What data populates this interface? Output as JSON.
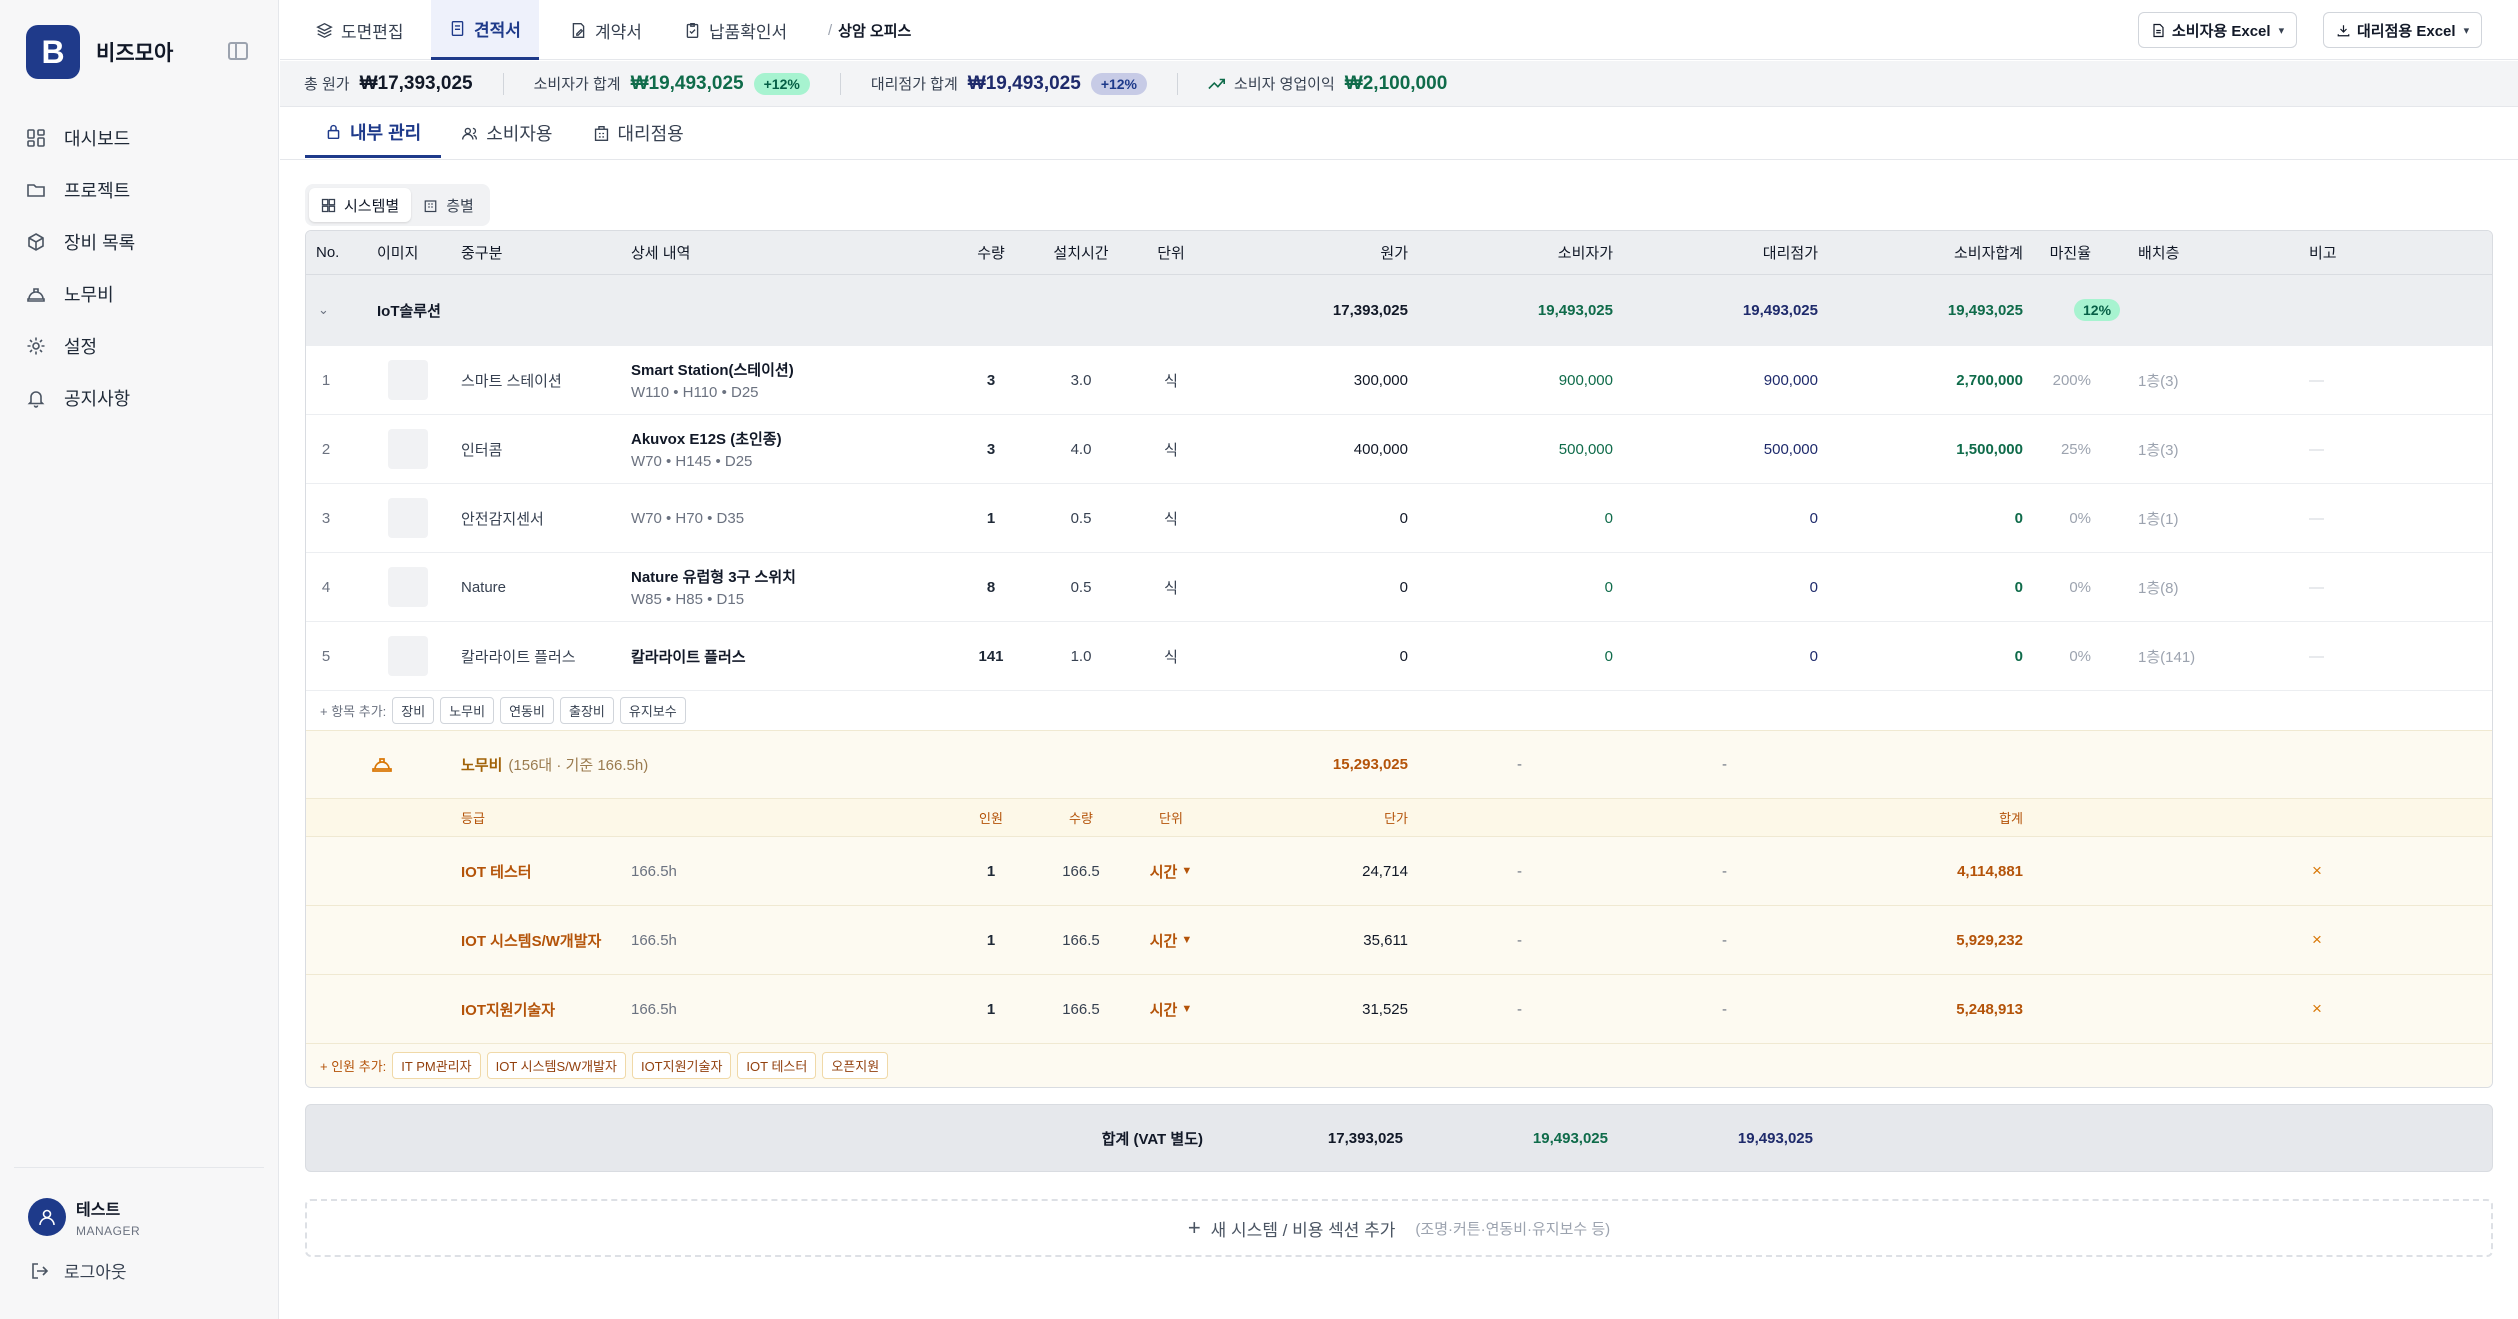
{
  "app": {
    "logo_letter": "B",
    "name": "비즈모아"
  },
  "sidebar": {
    "items": [
      {
        "label": "대시보드",
        "icon": "dashboard-icon"
      },
      {
        "label": "프로젝트",
        "icon": "folder-icon"
      },
      {
        "label": "장비 목록",
        "icon": "box-icon"
      },
      {
        "label": "노무비",
        "icon": "hardhat-icon"
      },
      {
        "label": "설정",
        "icon": "gear-icon"
      },
      {
        "label": "공지사항",
        "icon": "bell-icon"
      }
    ],
    "user": {
      "name": "테스트",
      "role": "MANAGER"
    },
    "logout": "로그아웃"
  },
  "top_tabs": [
    "도면편집",
    "견적서",
    "계약서",
    "납품확인서"
  ],
  "breadcrumb": {
    "sep": "/",
    "current": "상암 오피스"
  },
  "export": {
    "consumer": "소비자용 Excel",
    "dealer": "대리점용 Excel"
  },
  "summary": {
    "cost_label": "총 원가",
    "cost_value": "₩17,393,025",
    "consumer_label": "소비자가 합계",
    "consumer_value": "₩19,493,025",
    "consumer_pct": "+12%",
    "dealer_label": "대리점가 합계",
    "dealer_value": "₩19,493,025",
    "dealer_pct": "+12%",
    "profit_label": "소비자 영업이익",
    "profit_value": "₩2,100,000"
  },
  "sub_tabs": [
    "내부 관리",
    "소비자용",
    "대리점용"
  ],
  "view_toggle": [
    "시스템별",
    "층별"
  ],
  "table": {
    "headers": [
      "No.",
      "이미지",
      "중구분",
      "상세 내역",
      "수량",
      "설치시간",
      "단위",
      "원가",
      "소비자가",
      "대리점가",
      "소비자합계",
      "마진율",
      "배치층",
      "비고"
    ],
    "group": {
      "name": "IoT솔루션",
      "cost": "17,393,025",
      "consumer": "19,493,025",
      "dealer": "19,493,025",
      "consumer_total": "19,493,025",
      "margin": "12%"
    },
    "rows": [
      {
        "no": "1",
        "category": "스마트 스테이션",
        "title": "Smart Station(스테이션)",
        "spec": "W110 • H110 • D25",
        "qty": "3",
        "time": "3.0",
        "unit": "식",
        "cost": "300,000",
        "consumer": "900,000",
        "dealer": "900,000",
        "total": "2,700,000",
        "margin": "200%",
        "floor": "1층(3)",
        "note": "—"
      },
      {
        "no": "2",
        "category": "인터콤",
        "title": "Akuvox E12S (초인종)",
        "spec": "W70 • H145 • D25",
        "qty": "3",
        "time": "4.0",
        "unit": "식",
        "cost": "400,000",
        "consumer": "500,000",
        "dealer": "500,000",
        "total": "1,500,000",
        "margin": "25%",
        "floor": "1층(3)",
        "note": "—"
      },
      {
        "no": "3",
        "category": "안전감지센서",
        "title": "",
        "spec": "W70 • H70 • D35",
        "qty": "1",
        "time": "0.5",
        "unit": "식",
        "cost": "0",
        "consumer": "0",
        "dealer": "0",
        "total": "0",
        "margin": "0%",
        "floor": "1층(1)",
        "note": "—"
      },
      {
        "no": "4",
        "category": "Nature",
        "title": "Nature 유럽형 3구 스위치",
        "spec": "W85 • H85 • D15",
        "qty": "8",
        "time": "0.5",
        "unit": "식",
        "cost": "0",
        "consumer": "0",
        "dealer": "0",
        "total": "0",
        "margin": "0%",
        "floor": "1층(8)",
        "note": "—"
      },
      {
        "no": "5",
        "category": "칼라라이트 플러스",
        "title": "칼라라이트 플러스",
        "spec": "",
        "qty": "141",
        "time": "1.0",
        "unit": "식",
        "cost": "0",
        "consumer": "0",
        "dealer": "0",
        "total": "0",
        "margin": "0%",
        "floor": "1층(141)",
        "note": "—"
      }
    ],
    "add_item": {
      "label": "+ 항목 추가:",
      "chips": [
        "장비",
        "노무비",
        "연동비",
        "출장비",
        "유지보수"
      ]
    },
    "labor": {
      "title": "노무비",
      "sub": "(156대 · 기준 166.5h)",
      "cost": "15,293,025",
      "dash1": "-",
      "dash2": "-",
      "headers": {
        "grade": "등급",
        "people": "인원",
        "qty": "수량",
        "unit": "단위",
        "unit_price": "단가",
        "total": "합계"
      },
      "rows": [
        {
          "name": "IOT 테스터",
          "hours": "166.5h",
          "people": "1",
          "qty": "166.5",
          "unit": "시간",
          "price": "24,714",
          "d1": "-",
          "d2": "-",
          "total": "4,114,881"
        },
        {
          "name": "IOT 시스템S/W개발자",
          "hours": "166.5h",
          "people": "1",
          "qty": "166.5",
          "unit": "시간",
          "price": "35,611",
          "d1": "-",
          "d2": "-",
          "total": "5,929,232"
        },
        {
          "name": "IOT지원기술자",
          "hours": "166.5h",
          "people": "1",
          "qty": "166.5",
          "unit": "시간",
          "price": "31,525",
          "d1": "-",
          "d2": "-",
          "total": "5,248,913"
        }
      ],
      "add": {
        "label": "+ 인원 추가:",
        "chips": [
          "IT PM관리자",
          "IOT 시스템S/W개발자",
          "IOT지원기술자",
          "IOT 테스터",
          "오픈지원"
        ]
      }
    }
  },
  "totals": {
    "label": "합계 (VAT 별도)",
    "cost": "17,393,025",
    "consumer": "19,493,025",
    "dealer": "19,493,025"
  },
  "add_section": {
    "label": "새 시스템 / 비용 섹션 추가",
    "hint": "(조명·커튼·연동비·유지보수 등)"
  },
  "colors": {
    "navy": "#1e3a8a",
    "green": "#0f6b4a",
    "orange": "#b45309"
  }
}
